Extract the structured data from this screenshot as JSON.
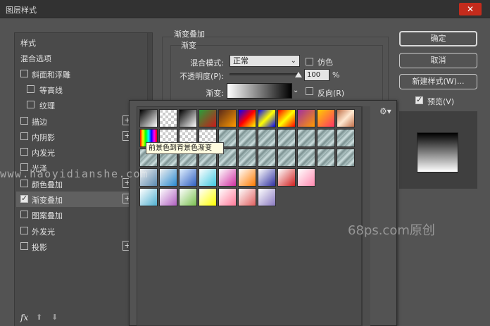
{
  "window": {
    "title": "图层样式",
    "close_symbol": "✕"
  },
  "left_list": {
    "items": [
      {
        "label": "样式",
        "checkbox": false,
        "checked": false,
        "plus": false,
        "indent": false
      },
      {
        "label": "混合选项",
        "checkbox": false,
        "checked": false,
        "plus": false,
        "indent": false
      },
      {
        "label": "斜面和浮雕",
        "checkbox": true,
        "checked": false,
        "plus": false,
        "indent": false
      },
      {
        "label": "等高线",
        "checkbox": true,
        "checked": false,
        "plus": false,
        "indent": true
      },
      {
        "label": "纹理",
        "checkbox": true,
        "checked": false,
        "plus": false,
        "indent": true
      },
      {
        "label": "描边",
        "checkbox": true,
        "checked": false,
        "plus": true,
        "indent": false
      },
      {
        "label": "内阴影",
        "checkbox": true,
        "checked": false,
        "plus": true,
        "indent": false
      },
      {
        "label": "内发光",
        "checkbox": true,
        "checked": false,
        "plus": false,
        "indent": false
      },
      {
        "label": "光泽",
        "checkbox": true,
        "checked": false,
        "plus": false,
        "indent": false
      },
      {
        "label": "颜色叠加",
        "checkbox": true,
        "checked": false,
        "plus": true,
        "indent": false
      },
      {
        "label": "渐变叠加",
        "checkbox": true,
        "checked": true,
        "plus": true,
        "indent": false,
        "selected": true
      },
      {
        "label": "图案叠加",
        "checkbox": true,
        "checked": false,
        "plus": false,
        "indent": false
      },
      {
        "label": "外发光",
        "checkbox": true,
        "checked": false,
        "plus": false,
        "indent": false
      },
      {
        "label": "投影",
        "checkbox": true,
        "checked": false,
        "plus": true,
        "indent": false
      }
    ],
    "plus_symbol": "+",
    "fx_label": "fx",
    "up_arrow": "⬆",
    "down_arrow": "⬇"
  },
  "gradient_overlay": {
    "section_title": "渐变叠加",
    "group_title": "渐变",
    "blend_mode_label": "混合模式:",
    "blend_mode_value": "正常",
    "dither_label": "仿色",
    "opacity_label": "不透明度(P):",
    "opacity_value": "100",
    "opacity_percent": 100,
    "opacity_unit": "%",
    "gradient_label": "渐变:",
    "reverse_label": "反向(R)",
    "chevron": "⌄"
  },
  "buttons": {
    "ok": "确定",
    "cancel": "取消",
    "new_style": "新建样式(W)...",
    "preview": "预览(V)",
    "preview_checked": true
  },
  "picker": {
    "gear_icon": "gear-icon",
    "gear_glyph": "⚙▾",
    "tooltip": "前景色到背景色渐变",
    "swatch_colors": {
      "fg_bg": [
        "#ffffff",
        "#000000"
      ],
      "primaries": [
        "#ff0000",
        "#ffff00",
        "#00ff00",
        "#00ffff",
        "#0000ff",
        "#ff00ff"
      ]
    }
  },
  "watermarks": {
    "url": "www.haoyidianshe.com",
    "brand": "68ps.com原创"
  }
}
